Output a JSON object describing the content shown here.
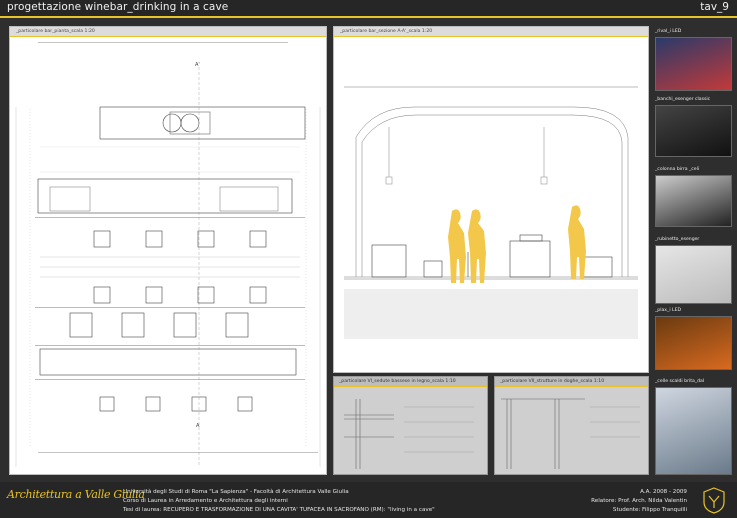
{
  "header": {
    "title": "progettazione winebar_drinking in a cave",
    "tav": "tav_9"
  },
  "panels": {
    "plan_title": "_particolare bar_pianta_scala 1:20",
    "section_title": "_particolare bar_sezione A-A'_scala 1:20",
    "chair_title": "_particolare VI_sedute bassese in legno_scala 1:10",
    "shelf_title": "_particolare VII_strutture in doghe_scala 1:10",
    "plan_marker_top": "A'",
    "plan_marker_bottom": "A"
  },
  "photos": [
    {
      "label": "_rival_i LED",
      "color_top": "#2a3a6a",
      "color_bottom": "#c23a3a"
    },
    {
      "label": "_banchi_esenger classic",
      "color_top": "#444",
      "color_bottom": "#111"
    },
    {
      "label": "_colonna birra _celi",
      "color_top": "#ccc",
      "color_bottom": "#222"
    },
    {
      "label": "_rubinetto_esenger",
      "color_top": "#e6e6e6",
      "color_bottom": "#bbb"
    },
    {
      "label": "_plax_i LED",
      "color_top": "#6a3a10",
      "color_bottom": "#d86a20"
    },
    {
      "label": "_celle scaldi brita_dal",
      "color_top": "#cfd6e0",
      "color_bottom": "#6a7a8a"
    }
  ],
  "footer": {
    "logo": "Architettura a Valle Giulia",
    "line1": "Università degli Studi di Roma \"La Sapienza\" - Facoltà di Architettura Valle Giulia",
    "line2": "Corso di Laurea in Arredamento e Architettura degli interni",
    "line3": "Tesi di laurea: RECUPERO E TRASFORMAZIONE DI UNA CAVITA' TUFACEA IN SACROFANO (RM): \"living in a cave\"",
    "year": "A.A. 2008 - 2009",
    "relatore": "Relatore: Prof. Arch. Nilda Valentin",
    "studente": "Studente: Filippo Tranquilli"
  },
  "colors": {
    "accent": "#e8c22a",
    "background": "#2e2e2e",
    "figure": "#f3c74a"
  }
}
